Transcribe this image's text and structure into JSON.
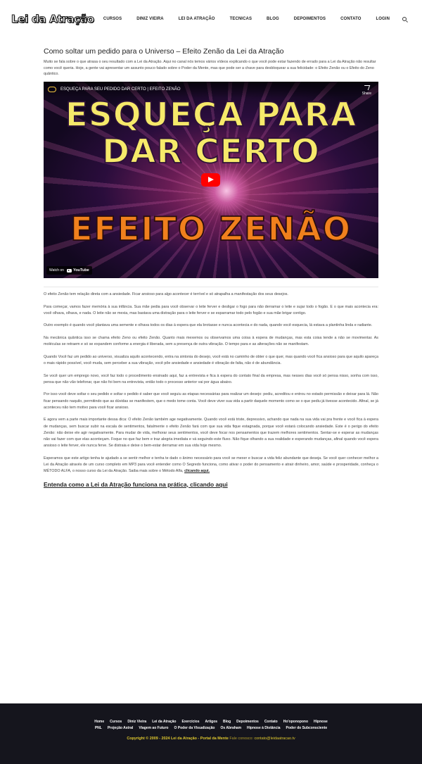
{
  "brand": {
    "logo_text": "Lei da Atração"
  },
  "nav": {
    "items": [
      "Home",
      "Cursos",
      "Diniz Vieira",
      "Lei da Atração",
      "Tecnicas",
      "Blog",
      "Depoimentos",
      "Contato",
      "Login"
    ],
    "search_icon": "search-icon"
  },
  "article": {
    "title": "Como soltar um pedido para o Universo – Efeito Zenão da Lei da Atração",
    "intro": "Muito se fala sobre o que atrasa o seu resultado com a Lei da Atração. Aqui no canal nós temos vários vídeos explicando o que você pode estar fazendo de errado para a Lei da Atração não resultar como você queria. Hoje, a gente vai apresentar um assunto pouco falado sobre o Poder da Mente, mas que pode ser a chave para desbloquear a sua felicidade: o Efeito Zenão ou o Efeito do Zeno quântico.",
    "video": {
      "caption": "ESQUEÇA PARA SEU PEDIDO DAR CERTO | EFEITO ZENÃO",
      "share_label": "Share",
      "headline_1": "ESQUEÇA PARA",
      "headline_2": "DAR CERTO",
      "subline": "EFEITO ZENÃO",
      "watch_on": "Watch on",
      "platform": "YouTube"
    },
    "paragraphs": [
      "O efeito Zenão tem relação direta com a ansiedade. Ficar ansioso para algo acontecer é terrível e só atrapalha a manifestação dos seus desejos.",
      "Para começar, vamos fazer memória à sua infância. Sua mãe pedia para você observar o leite ferver e desligar o fogo para não derramar o leite e sujar todo o fogão. E o que mais acontecia era: você olhava, olhava, e nada. O leite não se mexia, mas bastava uma distração para o leite ferver e se esparramar todo pelo fogão e sua mãe brigar contigo.",
      "Outro exemplo é quando você plantava uma semente e olhava todos os dias à espera que ela brotasse e nunca acontecia e do nada, quando você esquecia, lá estava a plantinha linda e radiante.",
      "Na mecânica quântica isso se chama efeito Zeno ou efeito Zenão. Quanto mais mexemos ou observamos uma coisa à espera de mudanças, mas esta coisa tende a não se movimentar. As moléculas se retraem e só se expandem conforme a energia é liberada, sem a presença de outra vibração. O tempo para e as alterações não se manifestam.",
      "Quando Você faz um pedido ao universo, visualiza aquilo acontecendo, entra na sintonia do desejo, você está no caminho de obter o que quer, mas quando você fica ansioso para que aquilo apareça o mais rápido possível, você muda, sem perceber a sua vibração, você põe ansiedade e ansiedade é vibração de falta, não é de abundância.",
      "Se você quer um emprego novo, você faz todo o procedimento ensinado aqui, faz a entrevista e fica à espera do contato final da empresa, mas nesses dias você só pensa nisso, sonha com isso, pensa que não vão telefonar, que não foi bem na entrevista, então todo o processo anterior vai por água abaixo.",
      "Por isso você deve soltar o seu pedido e soltar o pedido é saber que você seguiu as etapas necessárias para realizar um desejo: pediu, acreditou e entrou no estado permissão e deixar para lá. Não ficar pensando naquilo, permitindo que as dúvidas se manifestem, que o medo tome conta. Você deve viver sua vida a partir daquele momento como se o que pediu já tivesse acontecido. Afinal, se já aconteceu não tem motivo para você ficar ansioso.",
      "E agora vem a parte mais importante dessa dica: O efeito Zenão também age negativamente. Quando você está triste, depressivo, achando que nada na sua vida vai pra frente e você fica à espera de mudanças, sem buscar subir na escala de sentimentos, fatalmente o efeito Zenão fará com que sua vida fique estagnada, porque você estará colocando ansiedade. Este é o perigo do efeito Zenão: não deixe ele agir negativamente. Para mudar de vida, melhorar seus sentimentos, você deve focar nos pensamentos que trazem melhores sentimentos. Sentar-se e esperar as mudanças não vai fazer com que elas aconteçam. Foque no que faz bem e traz alegria imediata e vá seguindo este fluxo. Não fique olhando a sua realidade e esperando mudanças, afinal quando você espera ansioso o leite ferver, ele nunca ferve. Se distraia e deixe o bem-estar derramar em sua vida hoje mesmo."
    ],
    "closing": "Esperamos que este artigo tenha te ajudado a se sentir melhor e tenha te dado o ânimo necessário para você se mexer e buscar a vida feliz abundante que deseja. Se você quer conhecer melhor a Lei da Atração através de um curso completo em MP3 para você entender como O Segredo funciona, como ativar o poder do pensamento e atrair dinheiro, amor, saúde e prosperidade, conheça o MÉTODO ALFA, o nosso curso da Lei da Atração. Saiba mais sobre o Método Alfa,",
    "closing_link": "clicando aqui.",
    "cta": "Entenda como a Lei da Atração funciona na prática, clicando aqui"
  },
  "footer": {
    "row1": [
      "Home",
      "Cursos",
      "Diniz Vieira",
      "Lei da Atração",
      "Exercícios",
      "Artigos",
      "Blog",
      "Depoimentos",
      "Contato",
      "Ho'oponopono",
      "Hipnose"
    ],
    "row2": [
      "PNL",
      "Projeção Astral",
      "Viagem ao Futuro",
      "O Poder da Visualização",
      "Os Abraham",
      "Hipnose à Distância",
      "Poder do Subconsciente"
    ],
    "copyright": "Copyright © 2009 - 2024 Lei da Atração - Portal da Mente",
    "contact_label": "Fale conosco:",
    "email": "contato@leidaatracao.tv"
  },
  "colors": {
    "footer_bg": "#15151d",
    "footer_accent": "#e0c92e",
    "headline_yellow": "#f6e96a",
    "subline_orange": "#f0801d",
    "youtube_red": "#ff0000"
  }
}
